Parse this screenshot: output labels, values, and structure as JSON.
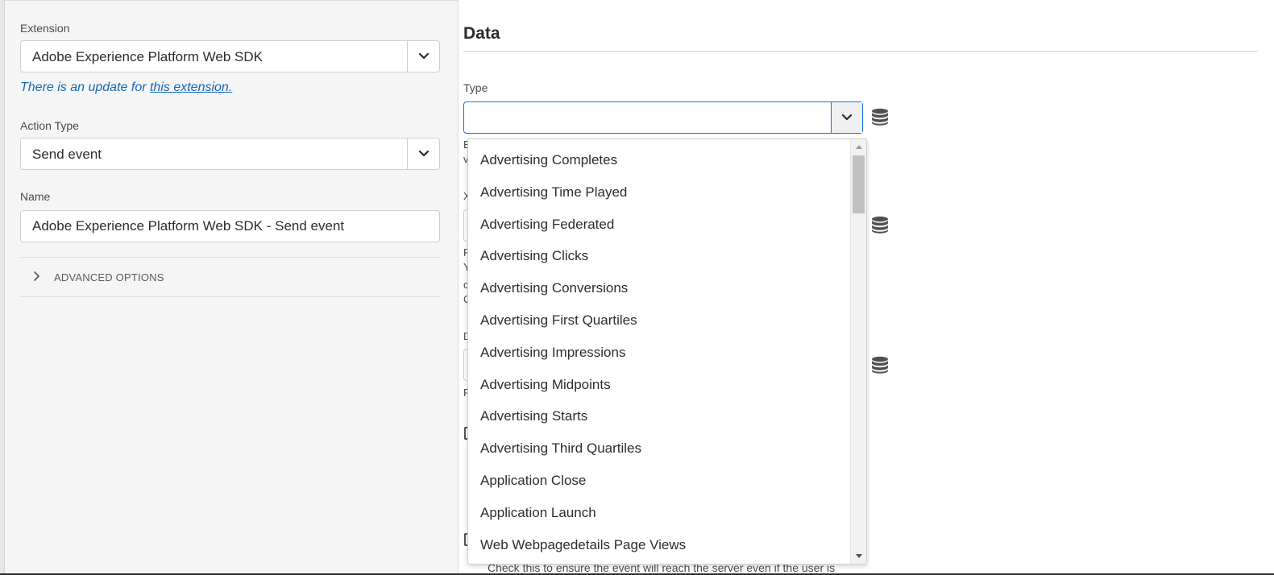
{
  "left": {
    "extension_label": "Extension",
    "extension_value": "Adobe Experience Platform Web SDK",
    "update_prefix": "There is an update for ",
    "update_link": "this extension.",
    "action_type_label": "Action Type",
    "action_type_value": "Send event",
    "name_label": "Name",
    "name_value": "Adobe Experience Platform Web SDK - Send event",
    "advanced_options": "ADVANCED OPTIONS"
  },
  "right": {
    "section_title": "Data",
    "type_label": "Type",
    "type_value": "",
    "partial_labels": {
      "p1": "E",
      "p2": "v",
      "p3": "X",
      "p4": "P",
      "p5": "Y",
      "p6": "c",
      "p7": "C",
      "p8": "D",
      "p9": "P"
    },
    "bottom_help": "Check this to ensure the event will reach the server even if the user is"
  },
  "dropdown_options": [
    "Advertising Completes",
    "Advertising Time Played",
    "Advertising Federated",
    "Advertising Clicks",
    "Advertising Conversions",
    "Advertising First Quartiles",
    "Advertising Impressions",
    "Advertising Midpoints",
    "Advertising Starts",
    "Advertising Third Quartiles",
    "Application Close",
    "Application Launch",
    "Web Webpagedetails Page Views"
  ],
  "icons": {
    "select_chevron": "chevron-down-icon",
    "data_element": "database-icon",
    "advanced_chevron": "chevron-right-icon"
  },
  "colors": {
    "link": "#1467b8",
    "focus_border": "#1473e6",
    "panel_bg": "#f5f5f5"
  }
}
